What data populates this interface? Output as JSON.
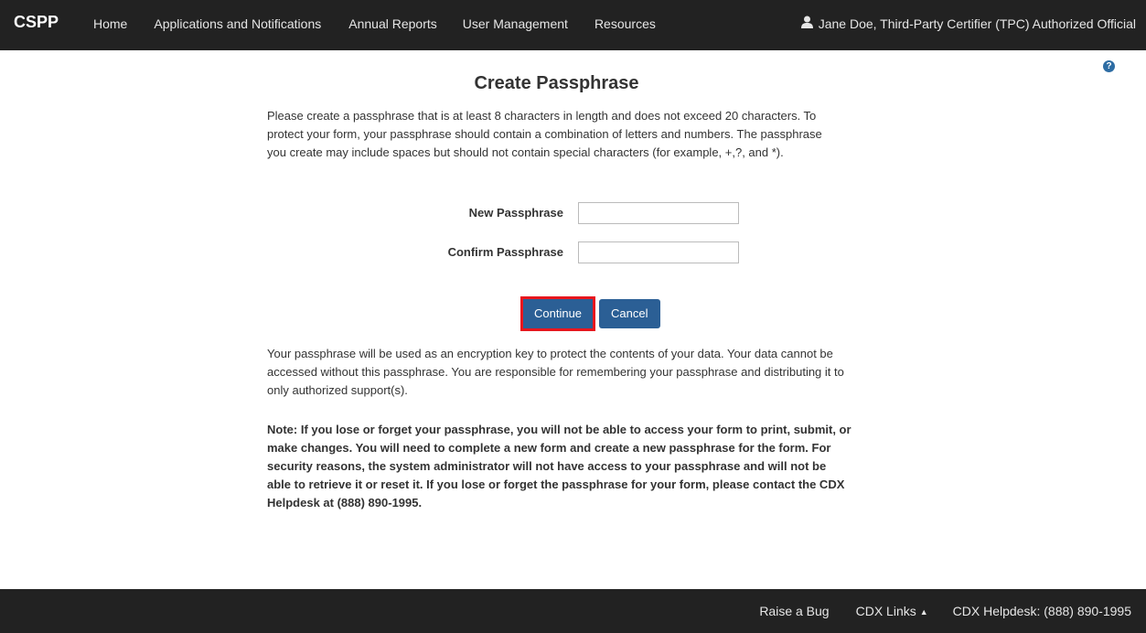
{
  "navbar": {
    "brand": "CSPP",
    "items": [
      {
        "label": "Home"
      },
      {
        "label": "Applications and Notifications"
      },
      {
        "label": "Annual Reports"
      },
      {
        "label": "User Management"
      },
      {
        "label": "Resources"
      }
    ],
    "user": {
      "icon": "user-icon",
      "label": "Jane Doe, Third-Party Certifier (TPC) Authorized Official"
    }
  },
  "help": {
    "icon": "question-circle-icon",
    "glyph": "?"
  },
  "page": {
    "title": "Create Passphrase",
    "intro": "Please create a passphrase that is at least 8 characters in length and does not exceed 20 characters. To protect your form, your passphrase should contain a combination of letters and numbers. The passphrase you create may include spaces but should not contain special characters (for example, +,?, and *).",
    "fields": {
      "new_label": "New Passphrase",
      "new_value": "",
      "confirm_label": "Confirm Passphrase",
      "confirm_value": ""
    },
    "buttons": {
      "continue": "Continue",
      "cancel": "Cancel"
    },
    "para2": "Your passphrase will be used as an encryption key to protect the contents of your data. Your data cannot be accessed without this passphrase. You are responsible for remembering your passphrase and distributing it to only authorized support(s).",
    "note": "Note: If you lose or forget your passphrase, you will not be able to access your form to print, submit, or make changes. You will need to complete a new form and create a new passphrase for the form. For security reasons, the system administrator will not have access to your passphrase and will not be able to retrieve it or reset it. If you lose or forget the passphrase for your form, please contact the CDX Helpdesk at (888) 890-1995."
  },
  "footer": {
    "raise_bug": "Raise a Bug",
    "cdx_links": "CDX Links",
    "helpdesk": "CDX Helpdesk: (888) 890-1995"
  },
  "colors": {
    "navbar": "#222222",
    "button": "#2b5f95",
    "highlight": "#e8161d"
  }
}
